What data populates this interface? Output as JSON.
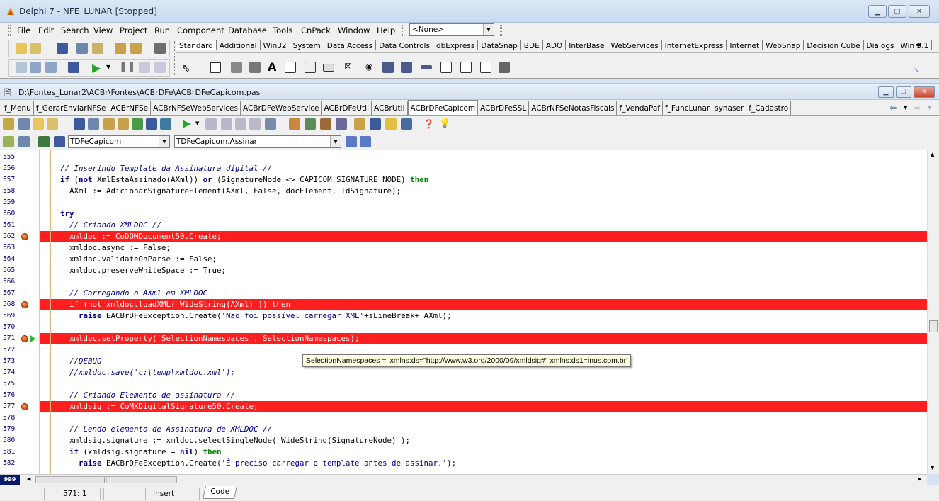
{
  "window": {
    "title": "Delphi 7 - NFE_LUNAR [Stopped]"
  },
  "menu": [
    "File",
    "Edit",
    "Search",
    "View",
    "Project",
    "Run",
    "Component",
    "Database",
    "Tools",
    "CnPack",
    "Window",
    "Help"
  ],
  "config_combo": "<None>",
  "palette_tabs": [
    "Standard",
    "Additional",
    "Win32",
    "System",
    "Data Access",
    "Data Controls",
    "dbExpress",
    "DataSnap",
    "BDE",
    "ADO",
    "InterBase",
    "WebServices",
    "InternetExpress",
    "Internet",
    "WebSnap",
    "Decision Cube",
    "Dialogs",
    "Win 3.1"
  ],
  "editor": {
    "path": "D:\\Fontes_Lunar2\\ACBr\\Fontes\\ACBrDFe\\ACBrDFeCapicom.pas",
    "unit_tabs": [
      "f_Menu",
      "f_GerarEnviarNFSe",
      "ACBrNFSe",
      "ACBrNFSeWebServices",
      "ACBrDFeWebService",
      "ACBrDFeUtil",
      "ACBrUtil",
      "ACBrDFeCapicom",
      "ACBrDFeSSL",
      "ACBrNFSeNotasFiscais",
      "f_VendaPaf",
      "f_FuncLunar",
      "synaser",
      "f_Cadastro"
    ],
    "active_tab": "ACBrDFeCapicom",
    "class_combo": "TDFeCapicom",
    "method_combo": "TDFeCapicom.Assinar"
  },
  "line_numbers": [
    "555",
    "556",
    "557",
    "558",
    "559",
    "560",
    "561",
    "562",
    "563",
    "564",
    "565",
    "566",
    "567",
    "568",
    "569",
    "570",
    "571",
    "572",
    "573",
    "574",
    "575",
    "576",
    "577",
    "578",
    "579",
    "580",
    "581",
    "582"
  ],
  "code_lines": [
    "",
    "    // Inserindo Template da Assinatura digital //",
    "    if (not XmlEstaAssinado(AXml)) or (SignatureNode <> CAPICOM_SIGNATURE_NODE) then",
    "      AXml := AdicionarSignatureElement(AXml, False, docElement, IdSignature);",
    "",
    "    try",
    "      // Criando XMLDOC //",
    "      xmldoc := CoDOMDocument50.Create;",
    "      xmldoc.async := False;",
    "      xmldoc.validateOnParse := False;",
    "      xmldoc.preserveWhiteSpace := True;",
    "",
    "      // Carregando o AXml em XMLDOC",
    "      if (not xmldoc.loadXML( WideString(AXml) )) then",
    "        raise EACBrDFeException.Create('Não foi possível carregar XML'+sLineBreak+ AXml);",
    "",
    "      xmldoc.setProperty('SelectionNamespaces', SelectionNamespaces);",
    "",
    "      //DEBUG",
    "      //xmldoc.save('c:\\temp\\xmldoc.xml');",
    "",
    "      // Criando Elemento de assinatura //",
    "      xmldsig := CoMXDigitalSignature50.Create;",
    "",
    "      // Lendo elemento de Assinatura de XMLDOC //",
    "      xmldsig.signature := xmldoc.selectSingleNode( WideString(SignatureNode) );",
    "      if (xmldsig.signature = nil) then",
    "        raise EACBrDFeException.Create('É preciso carregar o template antes de assinar.');"
  ],
  "tooltip": "SelectionNamespaces = 'xmlns:ds=\"http://www.w3.org/2000/09/xmldsig#\" xmlns:ds1=inus.com.br'",
  "status": {
    "position": "571: 1",
    "mode": "Insert",
    "view_tab": "Code"
  },
  "gutter_corner": "999",
  "colors": {
    "breakpoint_line": "#ff1f1f",
    "titlebar": "#c9daef"
  }
}
